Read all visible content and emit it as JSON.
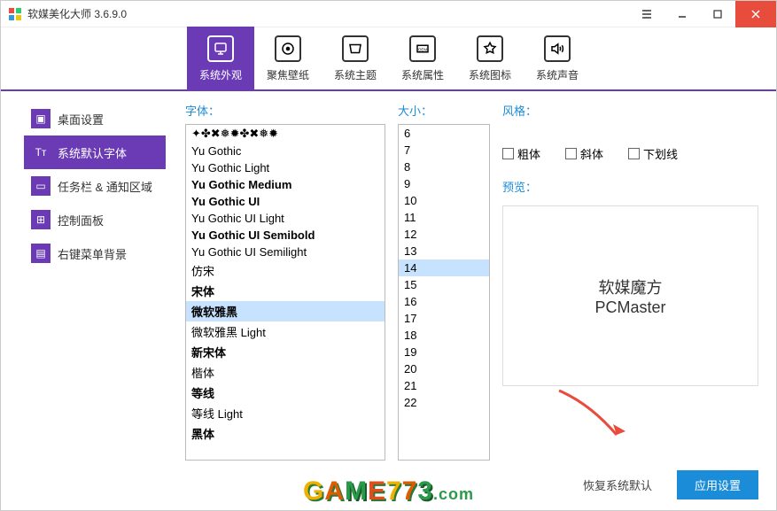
{
  "window": {
    "title": "软媒美化大师 3.6.9.0"
  },
  "toolbar": {
    "items": [
      {
        "label": "系统外观",
        "active": true
      },
      {
        "label": "聚焦壁纸"
      },
      {
        "label": "系统主题"
      },
      {
        "label": "系统属性"
      },
      {
        "label": "系统图标"
      },
      {
        "label": "系统声音"
      }
    ]
  },
  "sidebar": {
    "items": [
      {
        "label": "桌面设置"
      },
      {
        "label": "系统默认字体",
        "active": true
      },
      {
        "label": "任务栏 & 通知区域"
      },
      {
        "label": "控制面板"
      },
      {
        "label": "右键菜单背景"
      }
    ]
  },
  "fonts": {
    "label": "字体：",
    "items": [
      "✦✤✖❅✹✤✖❅✹",
      "Yu Gothic",
      "Yu Gothic Light",
      "Yu Gothic Medium",
      "Yu Gothic UI",
      "Yu Gothic UI Light",
      "Yu Gothic UI Semibold",
      "Yu Gothic UI Semilight",
      "仿宋",
      "宋体",
      "微软雅黑",
      "微软雅黑 Light",
      "新宋体",
      "楷体",
      "等线",
      "等线 Light",
      "黑体"
    ],
    "selected": "微软雅黑"
  },
  "sizes": {
    "label": "大小：",
    "items": [
      "6",
      "7",
      "8",
      "9",
      "10",
      "11",
      "12",
      "13",
      "14",
      "15",
      "16",
      "17",
      "18",
      "19",
      "20",
      "21",
      "22"
    ],
    "selected": "14"
  },
  "style": {
    "label": "风格：",
    "bold": "粗体",
    "italic": "斜体",
    "underline": "下划线"
  },
  "preview": {
    "label": "预览：",
    "line1": "软媒魔方",
    "line2": "PCMaster"
  },
  "buttons": {
    "reset": "恢复系统默认",
    "apply": "应用设置"
  }
}
